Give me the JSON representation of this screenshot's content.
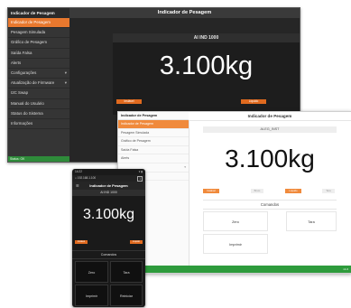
{
  "desktop": {
    "sidebar": {
      "brand": "Indicador de Pesagem",
      "items": [
        {
          "label": "Indicador de Pesagem",
          "active": true
        },
        {
          "label": "Pesagem Simulada"
        },
        {
          "label": "Gráfico de Pesagem"
        },
        {
          "label": "Saída Falsa"
        },
        {
          "label": "Alerts"
        },
        {
          "label": "Configurações",
          "chevron": true
        },
        {
          "label": "Atualização de Firmware",
          "chevron": true
        },
        {
          "label": "I2C Swap"
        },
        {
          "label": "Manual do Usuário"
        },
        {
          "label": "Status do Sistema"
        },
        {
          "label": "Informações"
        }
      ],
      "footer": "Status: OK"
    },
    "header": {
      "title": "Indicador de Pesagem"
    },
    "serial": "AI IND 1000",
    "weight": "3.100kg",
    "buttons": {
      "left": "Instável",
      "right": "Líquido"
    }
  },
  "tablet": {
    "sidebar": {
      "brand": "Indicador de Pesagem",
      "items": [
        {
          "label": "Indicador de Pesagem",
          "active": true
        },
        {
          "label": "Pesagem Simulada"
        },
        {
          "label": "Gráfico de Pesagem"
        },
        {
          "label": "Saída Falsa"
        },
        {
          "label": "Alerts"
        },
        {
          "label": "",
          "chevron": true
        },
        {
          "label": ""
        }
      ]
    },
    "header": {
      "title": "Indicador de Pesagem"
    },
    "serial": "ALEG_INST",
    "weight": "3.100kg",
    "buttons": [
      "Instável",
      "Bruto",
      "Líquido",
      "Tara"
    ],
    "commands": {
      "title": "Comandos",
      "zero": "Zero",
      "tare": "Tara",
      "print": "Imprimir"
    },
    "statusbar": "v1.0"
  },
  "phone": {
    "status": {
      "left": "14:22",
      "right": "▾ ▮"
    },
    "url": "⌂ 192.168.1.100",
    "url_tabs": "1",
    "header": {
      "menu": "☰",
      "title": "Indicador de Pesagem"
    },
    "serial": "AI IND 1000",
    "weight": "3.100kg",
    "buttons": {
      "left": "Instável",
      "right": "Líquido"
    },
    "commands": {
      "title": "Comandos",
      "zero": "Zero",
      "tare": "Tara",
      "print": "Imprimir",
      "reboot": "Reiniciar"
    }
  },
  "colors": {
    "accent": "#e8782e",
    "status_green": "#2e9b3c",
    "dark_bg": "#262626"
  }
}
